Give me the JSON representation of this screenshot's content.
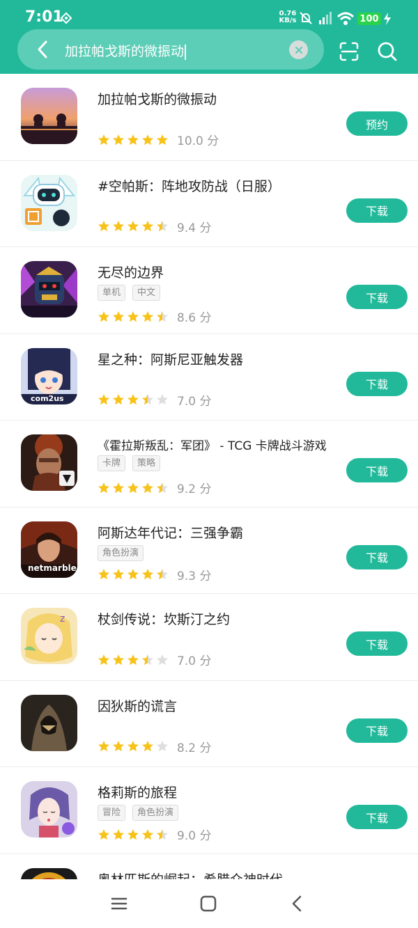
{
  "status": {
    "time": "7:01",
    "speed_value": "0.76",
    "speed_unit": "KB/s",
    "battery": "100"
  },
  "search": {
    "query": "加拉帕戈斯的微振动"
  },
  "colors": {
    "accent": "#21b99a",
    "star": "#f7c31b",
    "star_empty": "#dedede"
  },
  "results": [
    {
      "title": "加拉帕戈斯的微振动",
      "tags": [],
      "score": "10.0 分",
      "stars": 5,
      "button": "预约"
    },
    {
      "title": "#空帕斯：阵地攻防战（日服）",
      "tags": [],
      "score": "9.4 分",
      "stars": 4.5,
      "button": "下载"
    },
    {
      "title": "无尽的边界",
      "tags": [
        "单机",
        "中文"
      ],
      "score": "8.6 分",
      "stars": 4.5,
      "button": "下载"
    },
    {
      "title": "星之种：阿斯尼亚触发器",
      "tags": [],
      "score": "7.0 分",
      "stars": 3.5,
      "button": "下载"
    },
    {
      "title": "《霍拉斯叛乱：军团》 - TCG 卡牌战斗游戏",
      "tags": [
        "卡牌",
        "策略"
      ],
      "score": "9.2 分",
      "stars": 4.5,
      "button": "下载"
    },
    {
      "title": "阿斯达年代记：三强争霸",
      "tags": [
        "角色扮演"
      ],
      "score": "9.3 分",
      "stars": 4.5,
      "button": "下载"
    },
    {
      "title": "杖剑传说：坎斯汀之约",
      "tags": [],
      "score": "7.0 分",
      "stars": 3.5,
      "button": "下载"
    },
    {
      "title": "因狄斯的谎言",
      "tags": [],
      "score": "8.2 分",
      "stars": 4,
      "button": "下载"
    },
    {
      "title": "格莉斯的旅程",
      "tags": [
        "冒险",
        "角色扮演"
      ],
      "score": "9.0 分",
      "stars": 4.5,
      "button": "下载"
    },
    {
      "title": "奥林匹斯的崛起：希腊众神时代",
      "tags": [],
      "score": "",
      "stars": 0,
      "button": ""
    }
  ],
  "icon_labels": {
    "item4": "com2us",
    "item6": "netmarble"
  },
  "icons": [
    "back-icon",
    "clear-icon",
    "scan-icon",
    "search-icon",
    "menu-icon",
    "home-icon",
    "nav-back-icon"
  ]
}
